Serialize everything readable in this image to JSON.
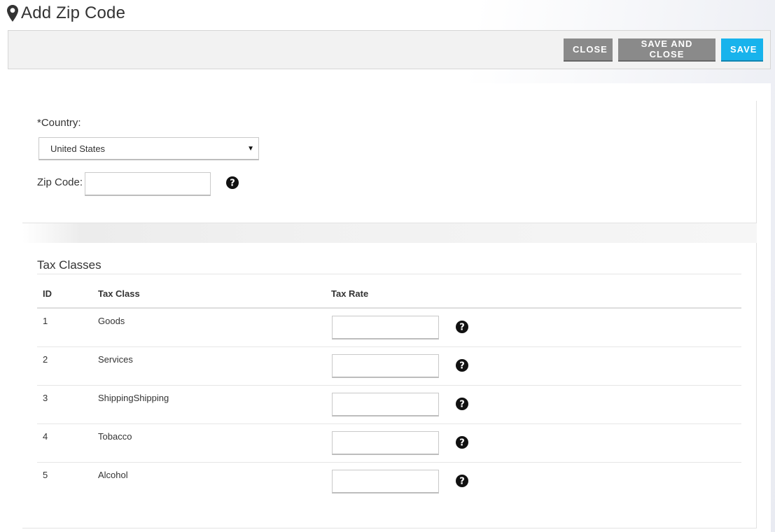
{
  "page": {
    "title": "Add Zip Code",
    "icon": "map-marker-icon"
  },
  "toolbar": {
    "close_label": "CLOSE",
    "save_and_close_label": "SAVE AND CLOSE",
    "save_label": "SAVE"
  },
  "location": {
    "country_label": "*Country:",
    "country_value": "United States",
    "zip_label": "Zip Code:",
    "zip_value": ""
  },
  "tax_classes": {
    "title": "Tax Classes",
    "columns": [
      "ID",
      "Tax Class",
      "Tax Rate"
    ],
    "rows": [
      {
        "id": "1",
        "name": "Goods",
        "rate": ""
      },
      {
        "id": "2",
        "name": "Services",
        "rate": ""
      },
      {
        "id": "3",
        "name": "ShippingShipping",
        "rate": ""
      },
      {
        "id": "4",
        "name": "Tobacco",
        "rate": ""
      },
      {
        "id": "5",
        "name": "Alcohol",
        "rate": ""
      }
    ]
  },
  "colors": {
    "button_gray": "#8a8a8a",
    "button_blue": "#18b3ec",
    "toolbar_bg": "#f2f2f2"
  }
}
